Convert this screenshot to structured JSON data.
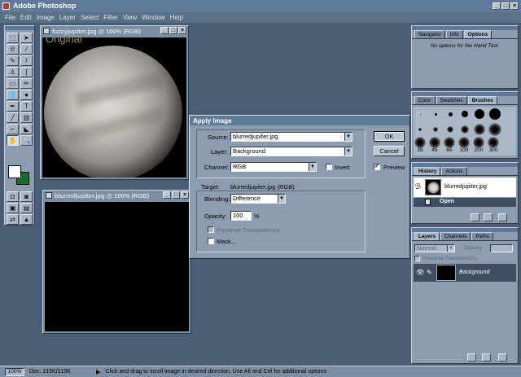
{
  "app": {
    "title": "Adobe Photoshop"
  },
  "menu": [
    "File",
    "Edit",
    "Image",
    "Layer",
    "Select",
    "Filter",
    "View",
    "Window",
    "Help"
  ],
  "window_controls": {
    "minimize": "_",
    "maximize": "□",
    "close": "×"
  },
  "doc1": {
    "title": "fuzzyjupiter.jpg @ 100% (RGB)",
    "overlay_text": "Original"
  },
  "doc2": {
    "title": "blurredjupiter.jpg @ 100% (RGB)"
  },
  "dialog": {
    "title": "Apply Image",
    "source_label": "Source:",
    "source_value": "blurredjupiter.jpg",
    "layer_label": "Layer:",
    "layer_value": "Background",
    "channel_label": "Channel:",
    "channel_value": "RGB",
    "invert_label": "Invert",
    "invert_checked": false,
    "target_label": "Target:",
    "target_value": "blurredjupiter.jpg (RGB)",
    "blending_label": "Blending:",
    "blending_value": "Difference",
    "opacity_label": "Opacity:",
    "opacity_value": "100",
    "opacity_unit": "%",
    "preserve_label": "Preserve Transparency",
    "mask_label": "Mask...",
    "ok_label": "OK",
    "cancel_label": "Cancel",
    "preview_label": "Preview",
    "preview_checked": true
  },
  "navigator_panel": {
    "tabs": [
      "Navigator",
      "Info",
      "Options"
    ],
    "active_tab": "Options",
    "message": "No options for the Hand Tool."
  },
  "brushes_panel": {
    "tabs": [
      "Color",
      "Swatches",
      "Brushes"
    ],
    "active_tab": "Brushes",
    "sizes": [
      "35",
      "45",
      "65",
      "100",
      "200",
      "300"
    ]
  },
  "history_panel": {
    "tabs": [
      "History",
      "Actions"
    ],
    "active_tab": "History",
    "snapshot": "blurredjupiter.jpg",
    "states": [
      "Open"
    ]
  },
  "layers_panel": {
    "tabs": [
      "Layers",
      "Channels",
      "Paths"
    ],
    "active_tab": "Layers",
    "mode": "Normal",
    "opacity_label": "Opacity:",
    "preserve_label": "Preserve Transparency",
    "layers": [
      "Background"
    ]
  },
  "statusbar": {
    "zoom": "100%",
    "doc": "Doc: 215K/215K",
    "hint": "Click and drag to scroll image in desired direction.  Use Alt and Ctrl for additional options"
  },
  "colors": {
    "title_active": "#5f7a98",
    "desktop": "#4a5d74",
    "panel": "#8d9db0"
  }
}
